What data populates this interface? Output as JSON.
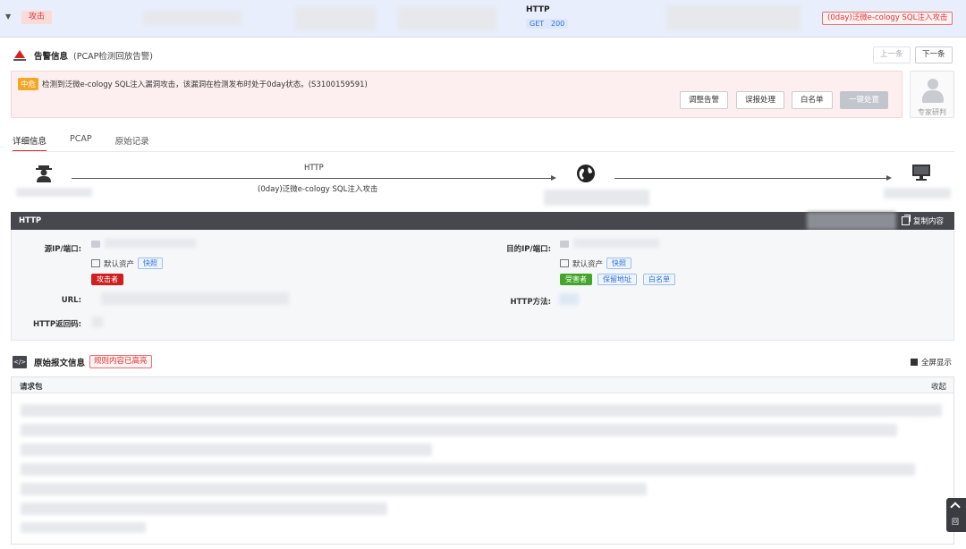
{
  "topbar": {
    "attack_tag": "攻击",
    "protocol": "HTTP",
    "method": "GET",
    "status_code": "200",
    "rule_tag": "(0day)泛微e-cology SQL注入攻击"
  },
  "alert": {
    "title": "告警信息",
    "subtitle": "(PCAP检测回放告警)",
    "prev_label": "上一条",
    "next_label": "下一条",
    "level": "中危",
    "message": "检测到泛微e-cology SQL注入漏洞攻击，该漏洞在检测发布时处于0day状态。(S3100159591)",
    "actions": {
      "adjust": "调整告警",
      "false_report": "误报处理",
      "whitelist": "白名单",
      "one_click": "一键处置"
    },
    "expert_label": "专家研判"
  },
  "tabs": [
    "详细信息",
    "PCAP",
    "原始记录"
  ],
  "flow": {
    "protocol": "HTTP",
    "rule": "(0day)泛微e-cology SQL注入攻击"
  },
  "http_panel": {
    "title": "HTTP",
    "copy_label": "复制内容",
    "src_label": "源IP/端口:",
    "dst_label": "目的IP/端口:",
    "default_asset": "默认资产",
    "snapshot": "快照",
    "attacker": "攻击者",
    "victim": "受害者",
    "reserved_addr": "保留地址",
    "whitelist": "白名单",
    "url_label": "URL:",
    "method_label": "HTTP方法:",
    "return_code_label": "HTTP返回码:"
  },
  "raw": {
    "title": "原始报文信息",
    "tag": "规则内容已高亮",
    "fullscreen": "全屏显示",
    "request_label": "请求包",
    "collapse": "收起"
  },
  "back_top": "回",
  "colors": {
    "accent_red": "#d62b2b",
    "attacker_red": "#cf1f1f",
    "victim_green": "#42a62a",
    "link_blue": "#2f6fd8",
    "dark_bar": "#46484e"
  }
}
